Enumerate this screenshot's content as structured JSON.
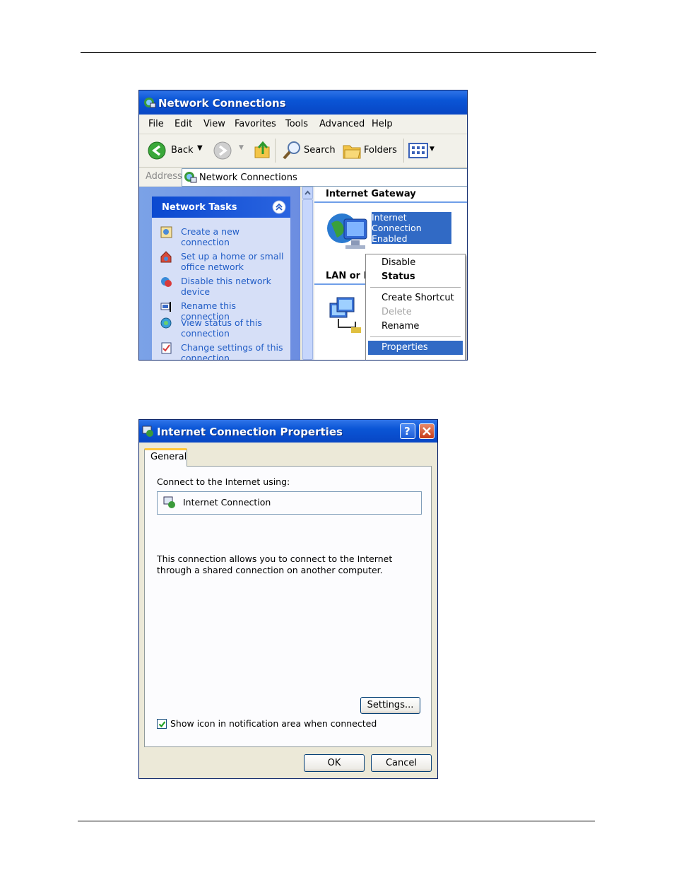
{
  "window1": {
    "title": "Network Connections",
    "menu": [
      "File",
      "Edit",
      "View",
      "Favorites",
      "Tools",
      "Advanced",
      "Help"
    ],
    "toolbar": {
      "back": "Back",
      "search": "Search",
      "folders": "Folders"
    },
    "address": {
      "label": "Address",
      "value": "Network Connections"
    },
    "network_tasks": {
      "title": "Network Tasks",
      "items": [
        {
          "label": "Create a new connection",
          "icon": "new-connection-icon"
        },
        {
          "label": "Set up a home or small office network",
          "icon": "home-network-icon"
        },
        {
          "label": "Disable this network device",
          "icon": "disable-device-icon"
        },
        {
          "label": "Rename this connection",
          "icon": "rename-icon"
        },
        {
          "label": "View status of this connection",
          "icon": "status-icon"
        },
        {
          "label": "Change settings of this connection",
          "icon": "settings-icon"
        }
      ]
    },
    "groups": {
      "internet_gateway": "Internet Gateway",
      "lan": "LAN or H"
    },
    "gateway_item": {
      "line1": "Internet Connection",
      "line2": "Enabled",
      "line3": "Internet Connection"
    },
    "context_menu": {
      "disable": "Disable",
      "status": "Status",
      "create_shortcut": "Create Shortcut",
      "delete": "Delete",
      "rename": "Rename",
      "properties": "Properties"
    }
  },
  "window2": {
    "title": "Internet Connection Properties",
    "tab": "General",
    "connect_label": "Connect to the Internet using:",
    "connection_name": "Internet Connection",
    "description": "This connection allows you to connect to the Internet through a shared connection on another computer.",
    "settings_button": "Settings...",
    "show_icon_label": "Show icon in notification area when connected",
    "show_icon_checked": true,
    "ok_button": "OK",
    "cancel_button": "Cancel"
  },
  "colors": {
    "xp_blue": "#0a55d6",
    "link_blue": "#215dc6",
    "highlight": "#316ac5",
    "dialog_bg": "#ece9d8"
  }
}
